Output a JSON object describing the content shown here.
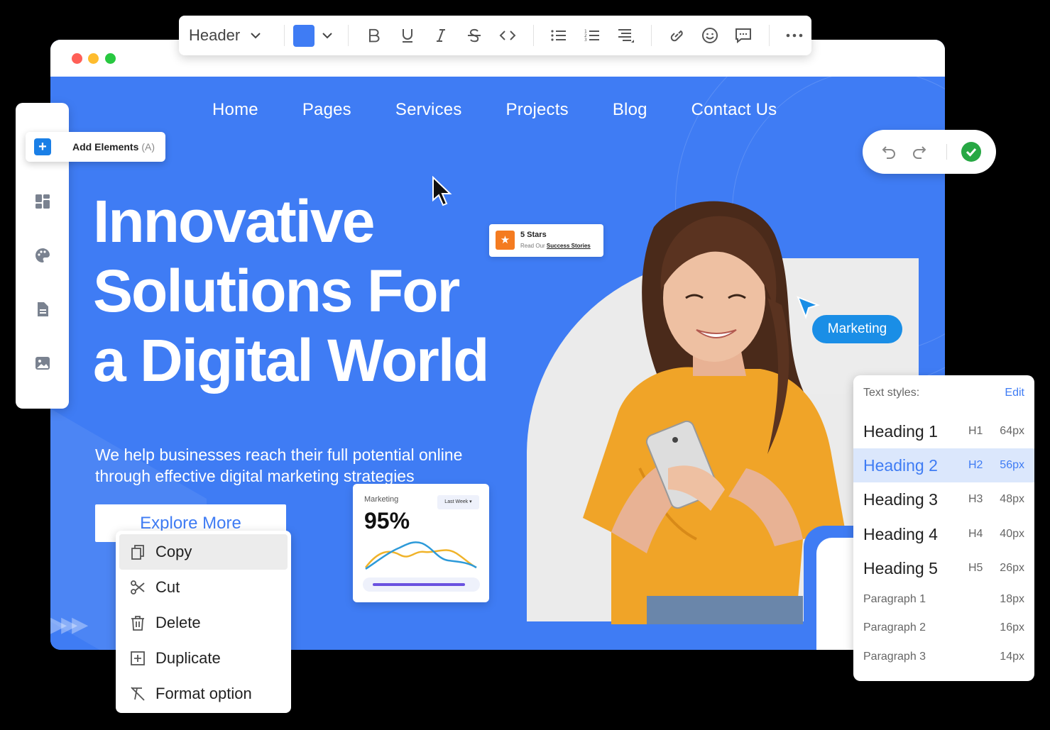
{
  "toolbar": {
    "block_type": "Header",
    "color": "#3f7cf4"
  },
  "sidebar": {
    "add_elements_label": "Add Elements",
    "add_elements_shortcut": "(A)"
  },
  "nav": [
    "Home",
    "Pages",
    "Services",
    "Projects",
    "Blog",
    "Contact Us"
  ],
  "hero": {
    "headline_line1": "Innovative",
    "headline_line2": "Solutions For",
    "headline_line3": "a Digital World",
    "subtext_line1": "We help businesses reach their full potential online",
    "subtext_line2": "through effective digital marketing strategies",
    "cta": "Explore More"
  },
  "stars_card": {
    "title": "5 Stars",
    "subtitle_prefix": "Read Our",
    "subtitle_link": "Success Stories"
  },
  "tag_pill": "Marketing",
  "mini_card": {
    "label": "Marketing",
    "range": "Last Week ▾",
    "percent": "95%",
    "progress": 0.95
  },
  "text_styles": {
    "title": "Text styles:",
    "edit": "Edit",
    "rows": [
      {
        "name": "Heading 1",
        "tag": "H1",
        "size": "64px"
      },
      {
        "name": "Heading 2",
        "tag": "H2",
        "size": "56px",
        "active": true
      },
      {
        "name": "Heading 3",
        "tag": "H3",
        "size": "48px"
      },
      {
        "name": "Heading 4",
        "tag": "H4",
        "size": "40px"
      },
      {
        "name": "Heading 5",
        "tag": "H5",
        "size": "26px"
      },
      {
        "name": "Paragraph 1",
        "tag": "",
        "size": "18px"
      },
      {
        "name": "Paragraph 2",
        "tag": "",
        "size": "16px"
      },
      {
        "name": "Paragraph 3",
        "tag": "",
        "size": "14px"
      }
    ]
  },
  "context_menu": {
    "items": [
      "Copy",
      "Cut",
      "Delete",
      "Duplicate",
      "Format option"
    ]
  },
  "colors": {
    "brand_blue": "#3f7cf4",
    "accent_cyan": "#1a8ee6",
    "success_green": "#27a844",
    "star_orange": "#f47b20"
  }
}
